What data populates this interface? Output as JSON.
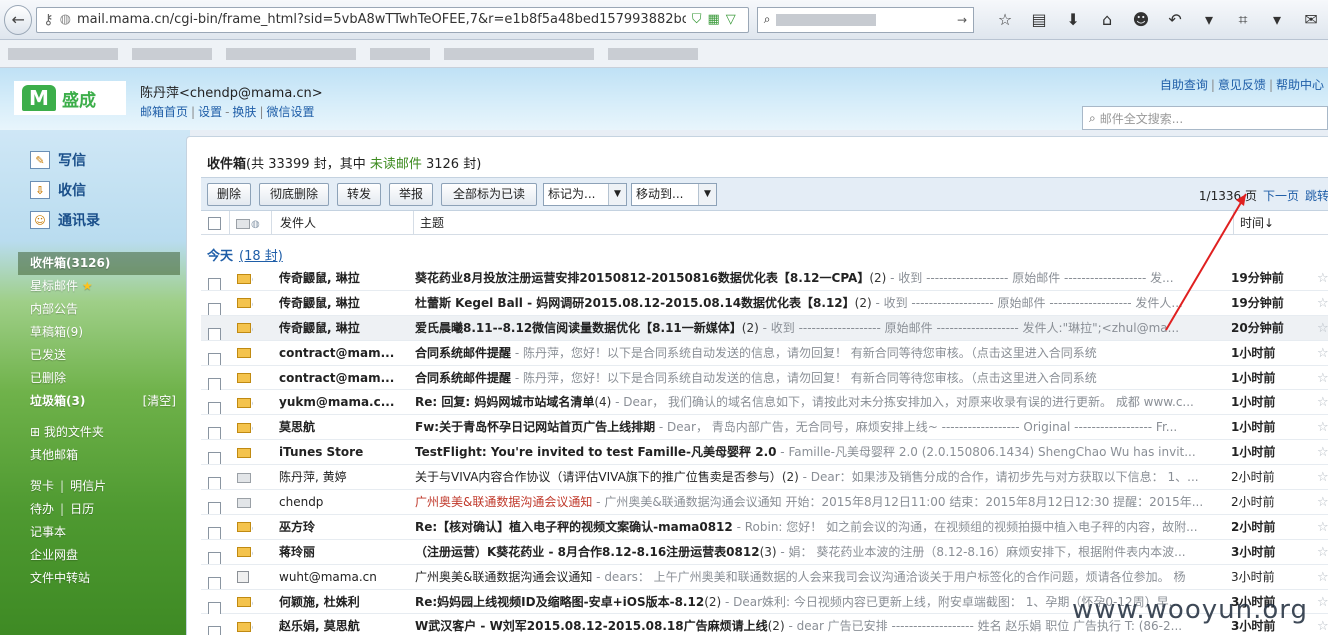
{
  "browser": {
    "url": "mail.mama.cn/cgi-bin/frame_html?sid=5vbA8wTTwhTeOFEE,7&r=e1b8f5a48bed157993882bd8dbc04"
  },
  "header": {
    "logo_text": "盛成",
    "user": "陈丹萍<chendp@mama.cn>",
    "links": [
      "邮箱首页",
      "设置",
      "换肤",
      "微信设置"
    ],
    "top_links": [
      "自助查询",
      "意见反馈",
      "帮助中心"
    ],
    "search_placeholder": "邮件全文搜索..."
  },
  "sidebar": {
    "main": [
      {
        "label": "写信",
        "icon": "compose-icon"
      },
      {
        "label": "收信",
        "icon": "receive-icon"
      },
      {
        "label": "通讯录",
        "icon": "contacts-icon"
      }
    ],
    "folders": [
      "收件箱(3126)",
      "星标邮件",
      "内部公告",
      "草稿箱(9)",
      "已发送",
      "已删除",
      "垃圾箱(3)"
    ],
    "clear_label": "[清空]",
    "extra": [
      "我的文件夹",
      "其他邮箱"
    ],
    "tools": {
      "greeting": "贺卡",
      "postcard": "明信片",
      "todo": "待办",
      "calendar": "日历",
      "notes": "记事本",
      "disk": "企业网盘",
      "transfer": "文件中转站"
    }
  },
  "inbox": {
    "title": "收件箱",
    "summary_pre": "(共 33399 封，其中 ",
    "unread_label": "未读邮件",
    "summary_post": " 3126 封)"
  },
  "toolbar": {
    "delete": "删除",
    "perm_delete": "彻底删除",
    "forward": "转发",
    "report": "举报",
    "mark_all_read": "全部标为已读",
    "mark_as": "标记为...",
    "move_to": "移动到...",
    "page": "1/1336 页",
    "next_page": "下一页",
    "jump": "跳转"
  },
  "columns": {
    "sender": "发件人",
    "subject": "主题",
    "time": "时间↓"
  },
  "group": {
    "label": "今天",
    "count": "(18 封)"
  },
  "rows": [
    {
      "from": "传奇鼹鼠, 琳拉",
      "subject": "葵花药业8月投放注册运营安排20150812-20150816数据优化表【8.12一CPA】",
      "count": "(2)",
      "preview": " - 收到 ------------------- 原始邮件 ------------------- 发...",
      "time": "19分钟前",
      "unread": true,
      "clip": true,
      "icon": "env"
    },
    {
      "from": "传奇鼹鼠, 琳拉",
      "subject": "杜蕾斯 Kegel Ball - 妈网调研2015.08.12-2015.08.14数据优化表【8.12】",
      "count": "(2)",
      "preview": " - 收到 ------------------- 原始邮件 ------------------- 发件人...",
      "time": "19分钟前",
      "unread": true,
      "clip": true,
      "icon": "env"
    },
    {
      "from": "传奇鼹鼠, 琳拉",
      "subject": "爱氏晨曦8.11--8.12微信阅读量数据优化【8.11一新媒体】",
      "count": "(2)",
      "preview": " - 收到 ------------------- 原始邮件 ------------------- 发件人:\"琳拉\";<zhul@ma...",
      "time": "20分钟前",
      "unread": true,
      "clip": true,
      "icon": "env",
      "hl": true
    },
    {
      "from": "contract@mam...",
      "subject": "合同系统邮件提醒",
      "count": "",
      "preview": " - 陈丹萍，您好！以下是合同系统自动发送的信息，请勿回复！ 有新合同等待您审核。（点击这里进入合同系统",
      "time": "1小时前",
      "unread": true,
      "clip": false,
      "icon": "env"
    },
    {
      "from": "contract@mam...",
      "subject": "合同系统邮件提醒",
      "count": "",
      "preview": " - 陈丹萍，您好！以下是合同系统自动发送的信息，请勿回复！ 有新合同等待您审核。（点击这里进入合同系统",
      "time": "1小时前",
      "unread": true,
      "clip": false,
      "icon": "env"
    },
    {
      "from": "yukm@mama.c...",
      "subject": "Re: 回复: 妈妈网城市站域名清单",
      "count": "(4)",
      "preview": " - Dear， 我们确认的域名信息如下，请按此对未分拣安排加入，对原来收录有误的进行更新。 成都 www.c...",
      "time": "1小时前",
      "unread": true,
      "clip": true,
      "icon": "env"
    },
    {
      "from": "莫思航",
      "subject": "Fw:关于青岛怀孕日记网站首页广告上线排期",
      "count": "",
      "preview": " - Dear， 青岛内部广告，无合同号，麻烦安排上线~ ------------------ Original ------------------ Fr...",
      "time": "1小时前",
      "unread": true,
      "clip": true,
      "icon": "env"
    },
    {
      "from": "iTunes Store",
      "subject": "TestFlight: You're invited to test Famille-凡美母婴秤 2.0",
      "count": "",
      "preview": " - Famille-凡美母婴秤 2.0 (2.0.150806.1434) ShengChao Wu has invit...",
      "time": "1小时前",
      "unread": true,
      "clip": false,
      "icon": "env"
    },
    {
      "from": "陈丹萍, 黄婷",
      "subject": "关于与VIVA内容合作协议（请评估VIVA旗下的推广位售卖是否参与）",
      "count": "(2)",
      "preview": " - Dear：如果涉及销售分成的合作，请初步先与对方获取以下信息：  1、...",
      "time": "2小时前",
      "unread": false,
      "clip": false,
      "icon": "read"
    },
    {
      "from": "chendp",
      "subject": "广州奥美&联通数据沟通会议通知",
      "count": "",
      "preview": " - 广州奥美&联通数据沟通会议通知 开始：2015年8月12日11:00 结束：2015年8月12日12:30 提醒：2015年...",
      "time": "2小时前",
      "unread": false,
      "clip": false,
      "icon": "read",
      "red": true
    },
    {
      "from": "巫方玲",
      "subject": "Re:【核对确认】植入电子秤的视频文案确认-mama0812",
      "count": "",
      "preview": " - Robin: 您好！ 如之前会议的沟通，在视频组的视频拍摄中植入电子秤的内容，故附...",
      "time": "2小时前",
      "unread": true,
      "clip": true,
      "icon": "env"
    },
    {
      "from": "蒋玲丽",
      "subject": "（注册运营）K葵花药业 - 8月合作8.12-8.16注册运营表0812",
      "count": "(3)",
      "preview": " - 娟： 葵花药业本波的注册（8.12-8.16）麻烦安排下，根据附件表内本波...",
      "time": "3小时前",
      "unread": true,
      "clip": true,
      "icon": "env"
    },
    {
      "from": "wuht@mama.cn",
      "subject": "广州奥美&联通数据沟通会议通知",
      "count": "",
      "preview": " - dears： 上午广州奥美和联通数据的人会来我司会议沟通洽谈关于用户标签化的合作问题，烦请各位参加。 杨",
      "time": "3小时前",
      "unread": false,
      "clip": false,
      "icon": "doc"
    },
    {
      "from": "何颖施, 杜姝利",
      "subject": "Re:妈妈园上线视频ID及缩略图-安卓+iOS版本-8.12",
      "count": "(2)",
      "preview": " - Dear姝利: 今日视频内容已更新上线，附安卓端截图： 1、孕期（怀孕0-12周）早...",
      "time": "3小时前",
      "unread": true,
      "clip": true,
      "icon": "env"
    },
    {
      "from": "赵乐娟, 莫思航",
      "subject": "W武汉客户 - W刘军2015.08.12-2015.08.18广告麻烦请上线",
      "count": "(2)",
      "preview": " - dear 广告已安排 ------------------- 姓名 赵乐娟 职位 广告执行 T: (86-2...",
      "time": "3小时前",
      "unread": true,
      "clip": true,
      "icon": "env"
    }
  ],
  "watermark": "www.wooyun.org"
}
